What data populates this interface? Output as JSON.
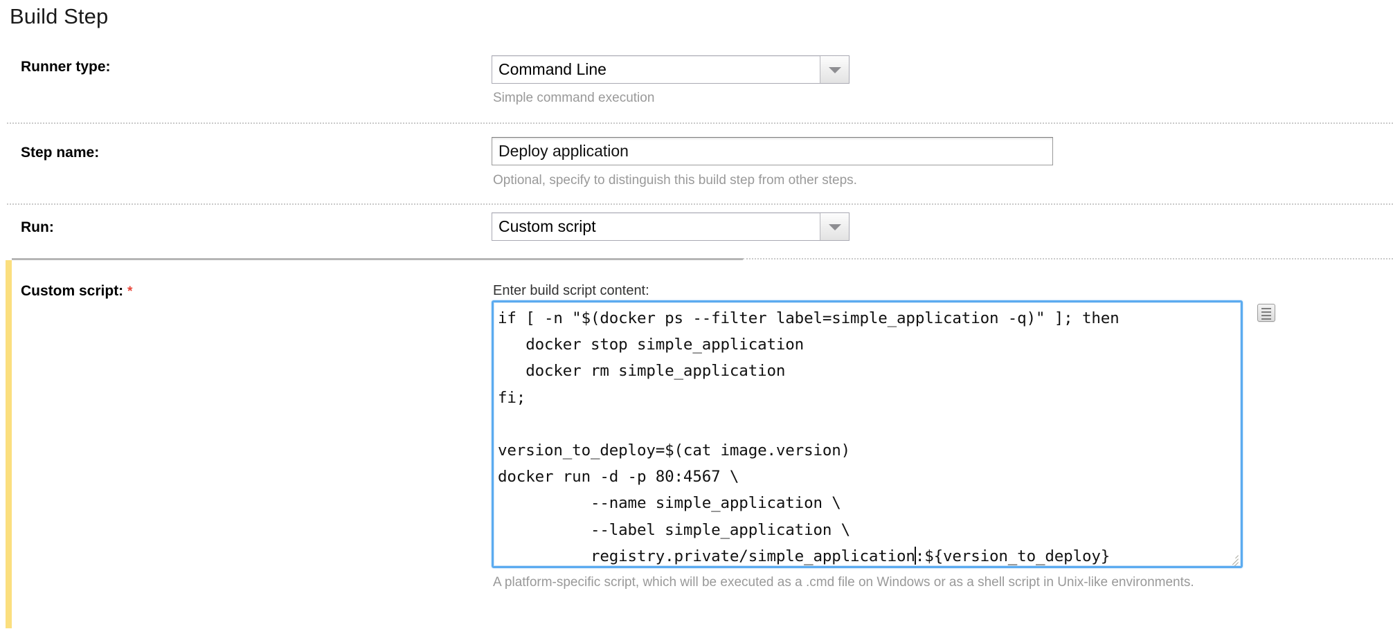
{
  "page": {
    "title": "Build Step"
  },
  "rows": {
    "runner_type": {
      "label": "Runner type:",
      "value": "Command Line",
      "hint": "Simple command execution",
      "dropdown_icon": "chevron-down-icon"
    },
    "step_name": {
      "label": "Step name:",
      "value": "Deploy application",
      "placeholder": "",
      "hint": "Optional, specify to distinguish this build step from other steps."
    },
    "run": {
      "label": "Run:",
      "value": "Custom script",
      "dropdown_icon": "chevron-down-icon"
    },
    "custom_script": {
      "label": "Custom script:",
      "required_marker": "*",
      "field_label": "Enter build script content:",
      "script_before_caret": "if [ -n \"$(docker ps --filter label=simple_application -q)\" ]; then\n   docker stop simple_application\n   docker rm simple_application\nfi;\n\nversion_to_deploy=$(cat image.version)\ndocker run -d -p 80:4567 \\\n          --name simple_application \\\n          --label simple_application \\\n          registry.private/simple_application",
      "script_after_caret": ":${version_to_deploy}",
      "hint": "A platform-specific script, which will be executed as a .cmd file on Windows or as a shell script in Unix-like environments.",
      "expand_icon": "lines-panel-icon",
      "resize_icon": "resize-grip-icon",
      "highlight_color": "#fbdf7f",
      "focus_color": "#5babf0"
    }
  }
}
